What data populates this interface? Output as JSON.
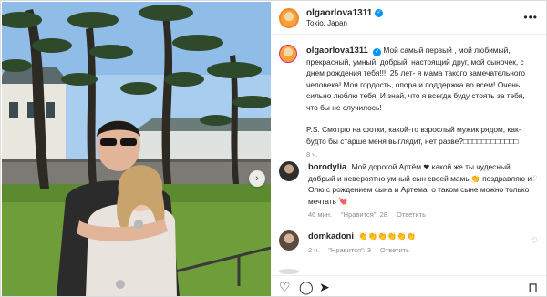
{
  "post": {
    "username": "olgaorlova1311",
    "location": "Tokio, Japan",
    "more_label": "•••"
  },
  "caption": {
    "username": "olgaorlova1311",
    "text": "Мой самый первый , мой любимый, прекрасный, умный, добрый, настоящий друг, мой сыночек, с днем рождения тебя!!!! 25 лет- я мама такого замечательного человека! Моя гордость, опора и поддержка во всем! Очень сильно люблю тебя! И знай, что я всегда буду стоять за тебя, что бы не случилось!",
    "ps": "P.S. Смотрю на фотки, какой-то взрослый мужик рядом, как-будто бы старше меня выглядит, нет разве?□□□□□□□□□□□□",
    "time": "8 ч."
  },
  "comments": [
    {
      "username": "borodylia",
      "text": "Мой дорогой Артём ❤ какой же ты чудесный, добрый и невероятно умный сын своей мамы👏 поздравляю и Олю с рождением сына и Артема, о таком сыне можно только мечтать 💘",
      "time": "46 мин.",
      "likes": "\"Нравится\": 28",
      "reply": "Ответить"
    },
    {
      "username": "domkadoni",
      "text": "👏👏👏👏👏👏",
      "time": "2 ч.",
      "likes": "\"Нравится\": 3",
      "reply": "Ответить"
    }
  ],
  "icons": {
    "heart": "♡",
    "comment": "◯",
    "share": "➤",
    "bookmark": "⊓",
    "next": "›"
  }
}
